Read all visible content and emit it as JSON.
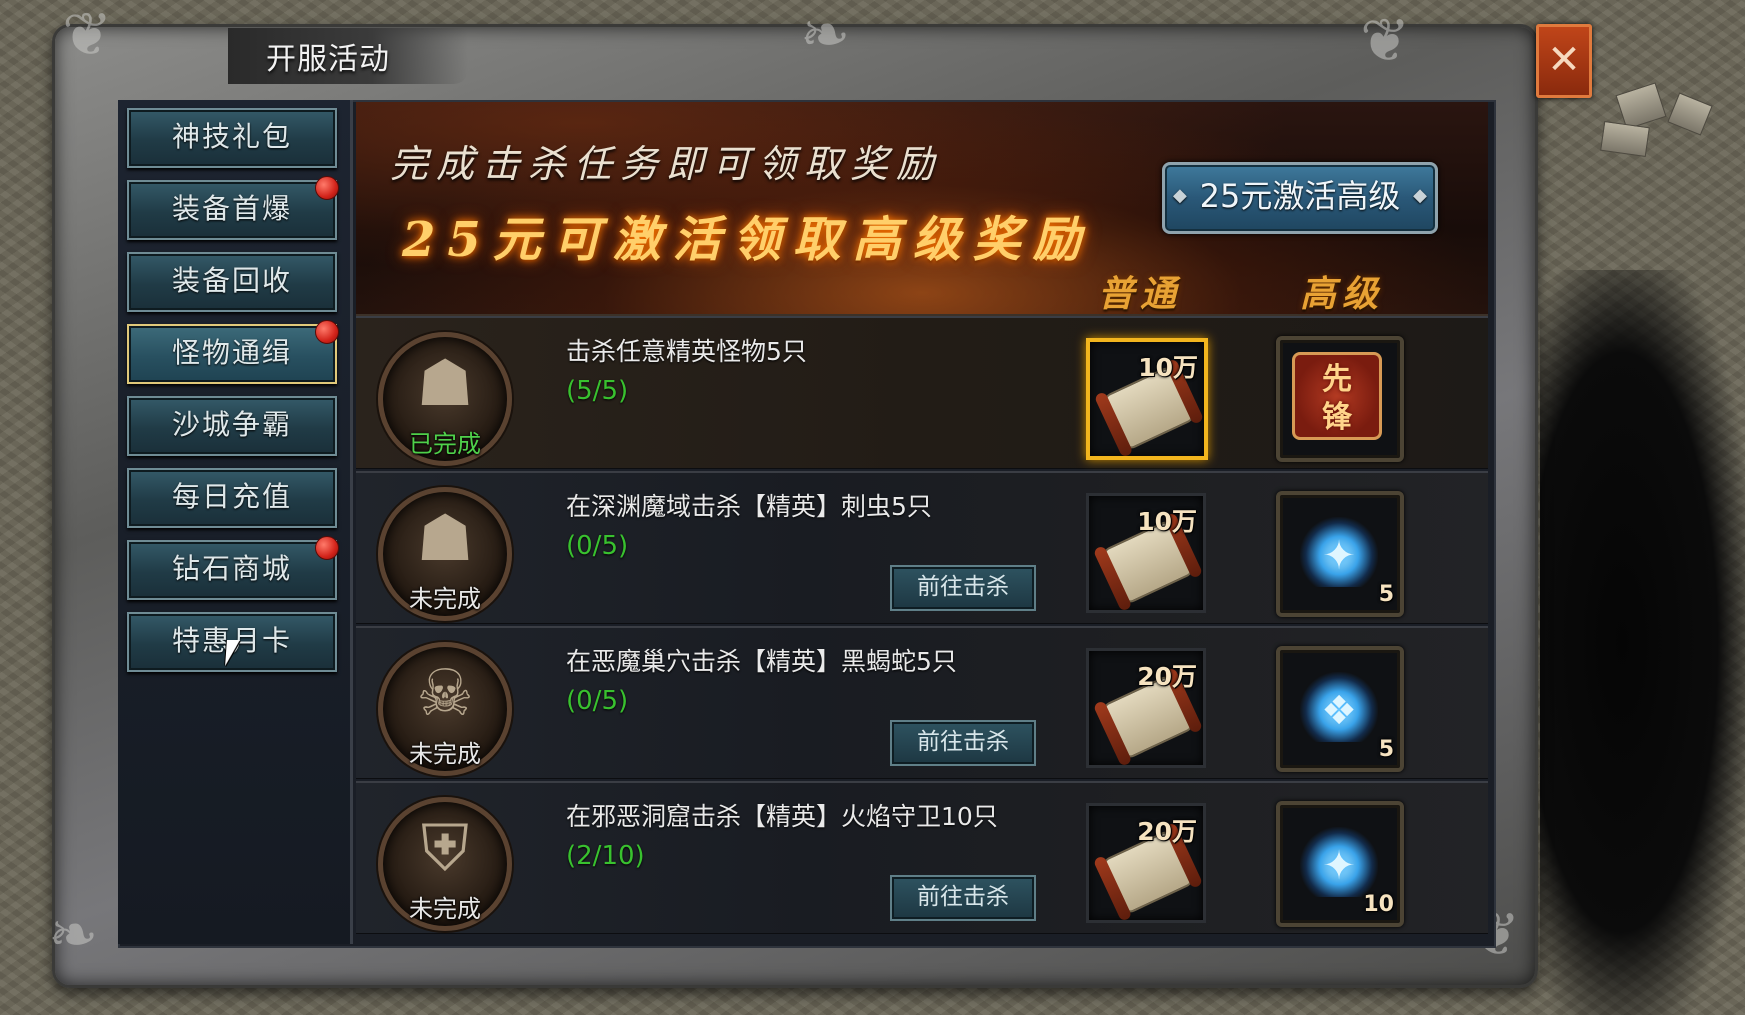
{
  "window": {
    "title": "开服活动",
    "close_icon": "close-icon"
  },
  "sidebar": {
    "items": [
      {
        "label": "神技礼包",
        "badge": false,
        "active": false
      },
      {
        "label": "装备首爆",
        "badge": true,
        "active": false
      },
      {
        "label": "装备回收",
        "badge": false,
        "active": false
      },
      {
        "label": "怪物通缉",
        "badge": true,
        "active": true
      },
      {
        "label": "沙城争霸",
        "badge": false,
        "active": false
      },
      {
        "label": "每日充值",
        "badge": false,
        "active": false
      },
      {
        "label": "钻石商城",
        "badge": true,
        "active": false
      },
      {
        "label": "特惠月卡",
        "badge": false,
        "active": false
      }
    ]
  },
  "banner": {
    "line1": "完成击杀任务即可领取奖励",
    "line2": "25元可激活领取高级奖励",
    "activate_label": "25元激活高级",
    "col_normal": "普通",
    "col_premium": "高级"
  },
  "tasks": [
    {
      "desc": "击杀任意精英怪物5只",
      "progress": "(5/5)",
      "status": "已完成",
      "go": "",
      "normal_count": "10万",
      "premium_label": "先锋",
      "premium_count": ""
    },
    {
      "desc": "在深渊魔域击杀【精英】刺虫5只",
      "progress": "(0/5)",
      "status": "未完成",
      "go": "前往击杀",
      "normal_count": "10万",
      "premium_label": "",
      "premium_count": "5"
    },
    {
      "desc": "在恶魔巢穴击杀【精英】黑蝎蛇5只",
      "progress": "(0/5)",
      "status": "未完成",
      "go": "前往击杀",
      "normal_count": "20万",
      "premium_label": "",
      "premium_count": "5"
    },
    {
      "desc": "在邪恶洞窟击杀【精英】火焰守卫10只",
      "progress": "(2/10)",
      "status": "未完成",
      "go": "前往击杀",
      "normal_count": "20万",
      "premium_label": "",
      "premium_count": "10"
    }
  ],
  "colors": {
    "accent_gold": "#f2b51e",
    "progress_green": "#39c12f",
    "status_done": "#4fd04a",
    "badge_red": "#d2231a"
  }
}
